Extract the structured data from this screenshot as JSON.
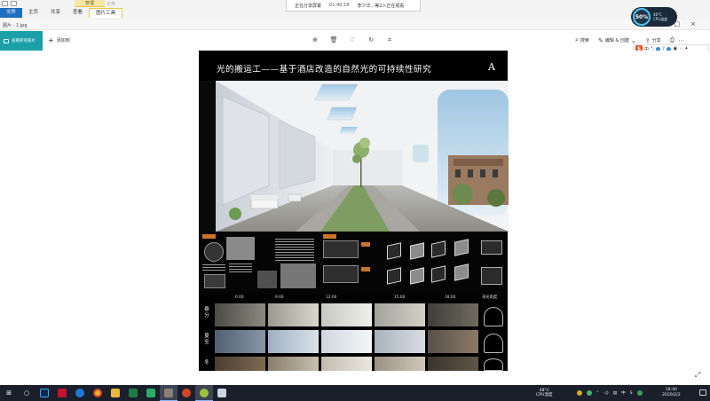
{
  "ribbon": {
    "context_group": "管理",
    "context_group_2": "工作",
    "tabs": [
      "文件",
      "主页",
      "共享",
      "查看",
      "图片工具"
    ]
  },
  "share_banner": {
    "status": "正在分享屏幕",
    "time": "01:40:18",
    "viewers": "李少华...等2人正在观看"
  },
  "photos_app": {
    "title": "图片 - 1.jpg",
    "see_all": "查看所有照片",
    "add_to": "添加到",
    "search": "搜索",
    "edit_create": "编辑 & 创建",
    "share": "分享"
  },
  "perf_widget": {
    "percent": "50%",
    "temp": "48°C",
    "label": "CPU温度"
  },
  "ime": {
    "logo": "S",
    "mode": "中"
  },
  "poster": {
    "title": "光的搬运工——基于酒店改造的自然光的可持续性研究",
    "letter": "A",
    "times": [
      "6:00",
      "9:00",
      "12:00",
      "15:00",
      "18:00"
    ],
    "side_label": "采光角度",
    "seasons": [
      {
        "name": "春分",
        "chars": [
          "春",
          "分"
        ]
      },
      {
        "name": "夏至",
        "chars": [
          "夏",
          "至"
        ]
      },
      {
        "name": "冬至",
        "chars": [
          "冬",
          "至"
        ]
      }
    ]
  },
  "taskbar": {
    "temp": "48°C",
    "temp_label": "CPU温度",
    "ime": "中",
    "time": "18:40",
    "date": "2020/2/2"
  },
  "colors": {
    "accent": "#1ba0a8",
    "ribbon_active": "#1f6fc0",
    "tag_orange": "#c8742a",
    "taskbar": "#1a1f2b"
  }
}
